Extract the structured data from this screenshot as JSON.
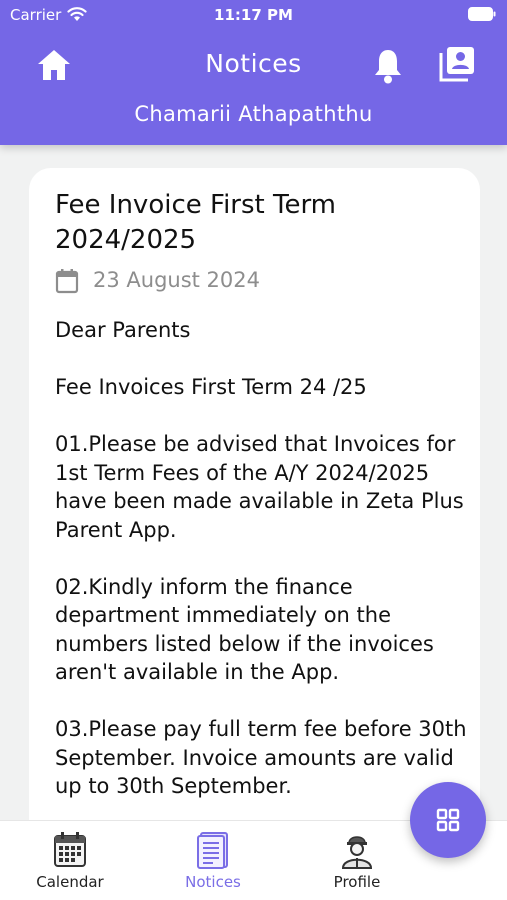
{
  "status_bar": {
    "carrier": "Carrier",
    "time": "11:17 PM"
  },
  "header": {
    "title": "Notices",
    "user_name": "Chamarii Athapaththu",
    "icons": [
      "home-icon",
      "bell-icon",
      "profile-book-icon"
    ]
  },
  "notice": {
    "title": "Fee Invoice First Term 2024/2025",
    "date": "23 August 2024",
    "body": "Dear Parents\n\nFee Invoices First Term 24 /25\n\n01.Please be advised that Invoices for 1st Term Fees of the A/Y 2024/2025 have been made available in Zeta Plus Parent App.\n\n02.Kindly inform the finance department immediately on the numbers listed below if the invoices aren't available in the App.\n\n03.Please pay full term fee before 30th September. Invoice amounts are valid up to 30th September."
  },
  "tabs": [
    {
      "label": "Calendar",
      "icon": "calendar-icon",
      "active": false
    },
    {
      "label": "Notices",
      "icon": "notices-icon",
      "active": true
    },
    {
      "label": "Profile",
      "icon": "profile-icon",
      "active": false
    }
  ],
  "fab": {
    "icon": "grid-icon"
  },
  "colors": {
    "primary": "#7567e6",
    "active_tab": "#7a6ee6",
    "background": "#f1f2f2",
    "muted": "#8d8d8d"
  }
}
